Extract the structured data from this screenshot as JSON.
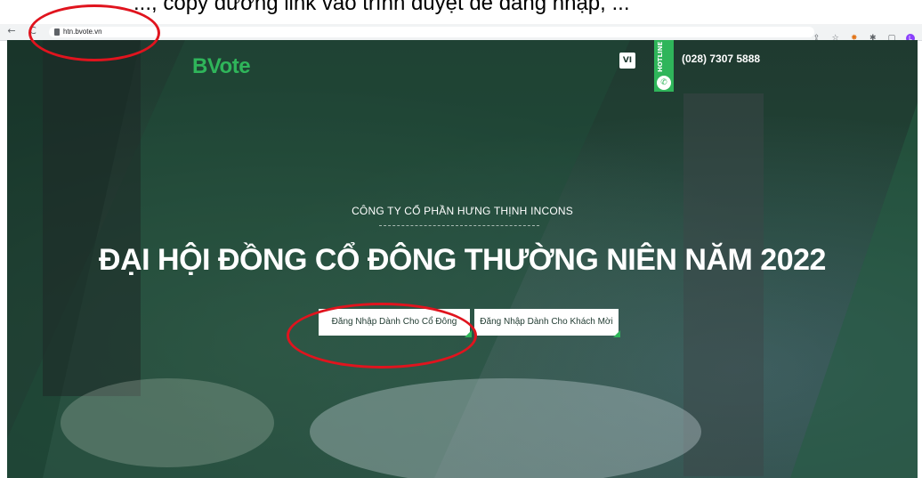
{
  "caption": {
    "text": "..., copy đường link vào trình duyệt để đăng nhập, ..."
  },
  "browser": {
    "back_glyph": "←",
    "reload_glyph": "C",
    "url": "htn.bvote.vn",
    "extension_glyphs": [
      "⇪",
      "☆",
      "✸",
      "✱",
      "▢",
      "L"
    ]
  },
  "header": {
    "logo": "BVote",
    "language": "VI",
    "hotline_label": "HOTLINE",
    "phone_glyph": "✆",
    "phone_number": "(028) 7307 5888"
  },
  "hero": {
    "company": "CÔNG TY CỔ PHẦN HƯNG THỊNH INCONS",
    "headline": "ĐẠI HỘI ĐỒNG CỔ ĐÔNG THƯỜNG NIÊN NĂM 2022",
    "shareholder_login": "Đăng Nhập Dành Cho Cổ Đông",
    "guest_login": "Đăng Nhập Dành Cho Khách Mời"
  },
  "colors": {
    "brand_green": "#2fb55a",
    "hero_dark": "#1f3a30",
    "annotation_red": "#e0141e"
  }
}
